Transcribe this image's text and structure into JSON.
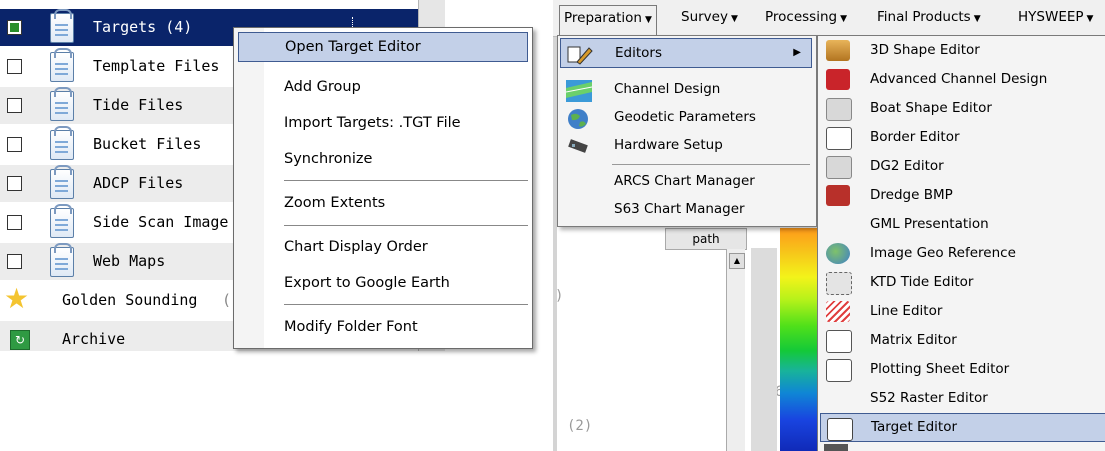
{
  "tree": {
    "items": [
      {
        "label": "Targets (4)",
        "checked": true,
        "icon": "document-icon",
        "selected": true
      },
      {
        "label": "Template Files",
        "checked": false,
        "icon": "document-icon"
      },
      {
        "label": "Tide Files",
        "checked": false,
        "icon": "document-icon"
      },
      {
        "label": "Bucket Files",
        "checked": false,
        "icon": "document-icon"
      },
      {
        "label": "ADCP Files",
        "checked": false,
        "icon": "document-icon"
      },
      {
        "label": "Side Scan Image",
        "checked": false,
        "icon": "document-icon"
      },
      {
        "label": "Web Maps",
        "checked": false,
        "icon": "document-icon"
      },
      {
        "label": "Golden Sounding",
        "icon": "star-icon",
        "suffix": "("
      },
      {
        "label": "Archive",
        "icon": "archive-icon"
      }
    ]
  },
  "context_menu": {
    "items": [
      {
        "label": "Open Target Editor",
        "highlighted": true
      },
      {
        "label": "Add Group"
      },
      {
        "label": "Import Targets: .TGT File"
      },
      {
        "label": "Synchronize"
      },
      {
        "label": "Zoom Extents"
      },
      {
        "label": "Chart Display Order"
      },
      {
        "label": "Export to Google Earth"
      },
      {
        "label": "Modify Folder Font"
      }
    ]
  },
  "menubar": {
    "items": [
      {
        "label": "Preparation",
        "open": true
      },
      {
        "label": "Survey"
      },
      {
        "label": "Processing"
      },
      {
        "label": "Final Products"
      },
      {
        "label": "HYSWEEP"
      }
    ]
  },
  "preparation_menu": {
    "items": [
      {
        "label": "Editors",
        "has_submenu": true,
        "highlighted": true,
        "icon": "editors-icon"
      },
      {
        "label": "Channel Design",
        "icon": "channel-design-icon"
      },
      {
        "label": "Geodetic Parameters",
        "icon": "globe-icon"
      },
      {
        "label": "Hardware Setup",
        "icon": "hardware-icon"
      },
      {
        "label": "ARCS Chart Manager"
      },
      {
        "label": "S63 Chart Manager"
      }
    ]
  },
  "editors_submenu": {
    "items": [
      {
        "label": "3D Shape Editor",
        "icon": "3d-shape-icon"
      },
      {
        "label": "Advanced Channel Design",
        "icon": "advanced-channel-icon"
      },
      {
        "label": "Boat Shape Editor",
        "icon": "boat-shape-icon"
      },
      {
        "label": "Border Editor",
        "icon": "border-editor-icon"
      },
      {
        "label": "DG2 Editor",
        "icon": "dg2-editor-icon"
      },
      {
        "label": "Dredge BMP",
        "icon": "dredge-icon"
      },
      {
        "label": "GML Presentation"
      },
      {
        "label": "Image Geo Reference",
        "icon": "globe-icon"
      },
      {
        "label": "KTD Tide Editor",
        "icon": "ktd-tide-icon"
      },
      {
        "label": "Line Editor",
        "icon": "line-editor-icon"
      },
      {
        "label": "Matrix Editor",
        "icon": "matrix-editor-icon"
      },
      {
        "label": "Plotting Sheet Editor",
        "icon": "plotting-sheet-icon"
      },
      {
        "label": "S52 Raster Editor"
      },
      {
        "label": "Target Editor",
        "icon": "target-editor-icon",
        "highlighted": true
      }
    ]
  },
  "background": {
    "path_header": "path",
    "faint_text_1": ")",
    "faint_text_2": "(2)",
    "faint_text_3": "6"
  }
}
